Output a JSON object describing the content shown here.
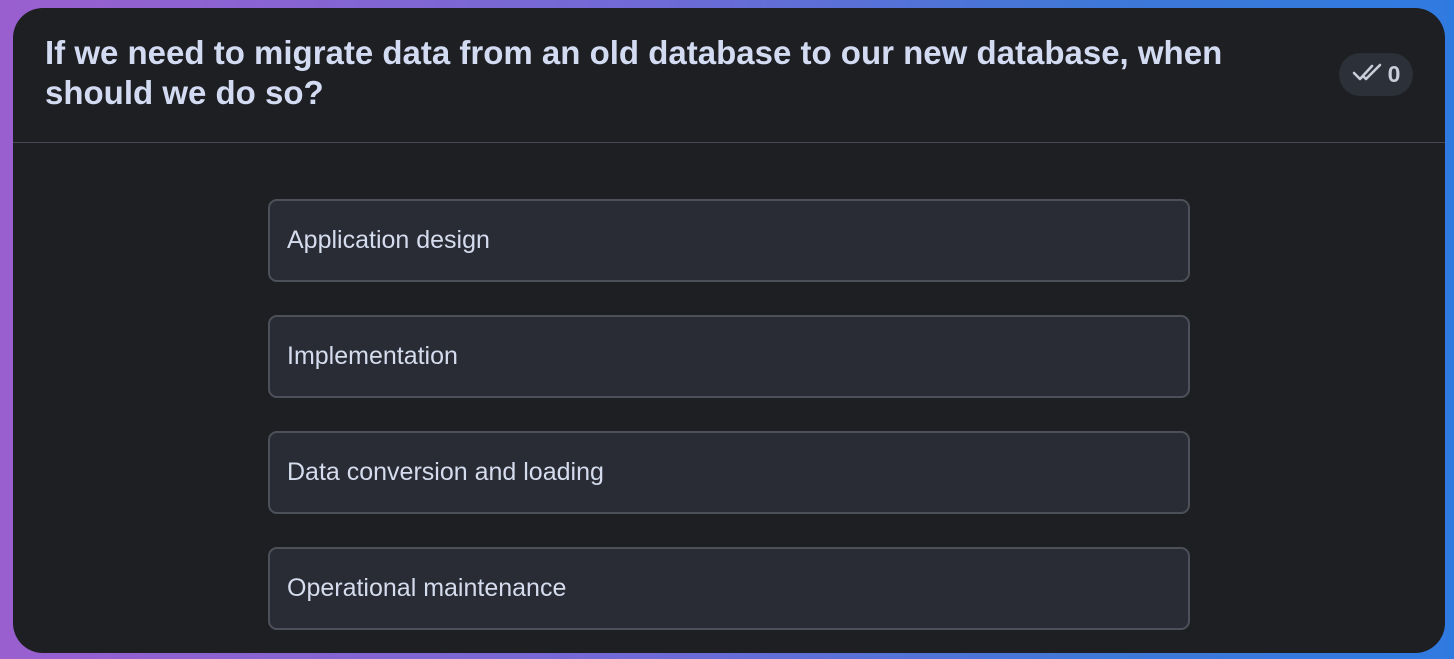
{
  "question": "If we need to migrate data from an old database to our new database, when should we do so?",
  "badge": {
    "icon": "double-check-icon",
    "count": "0"
  },
  "options": [
    {
      "label": "Application design"
    },
    {
      "label": "Implementation"
    },
    {
      "label": "Data conversion and loading"
    },
    {
      "label": "Operational maintenance"
    }
  ],
  "colors": {
    "card_background": "#1e1f22",
    "option_background": "#292c35",
    "option_border": "#4c5159",
    "text": "#d3dbf2"
  }
}
